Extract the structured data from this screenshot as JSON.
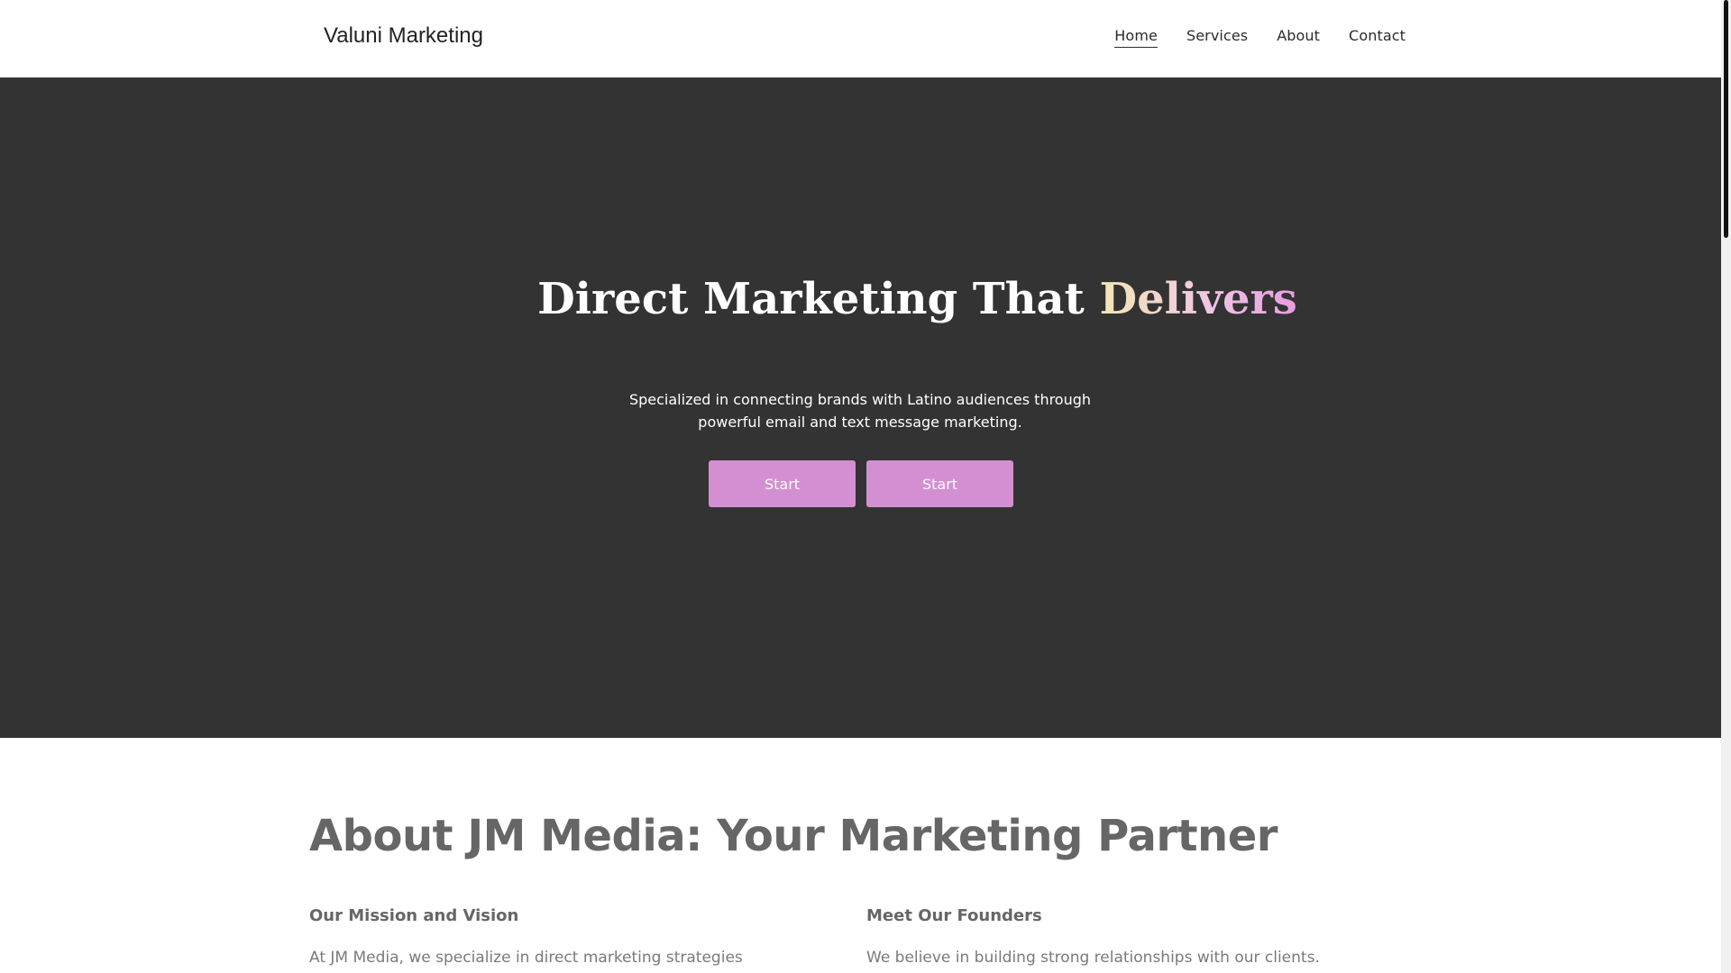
{
  "header": {
    "brand": "Valuni Marketing",
    "nav": [
      "Home",
      "Services",
      "About",
      "Contact"
    ],
    "active_nav": "Home"
  },
  "hero": {
    "title_main": "Direct Marketing That ",
    "title_accent": "Delivers",
    "subtitle": "Specialized in connecting brands with Latino audiences through powerful email and text message marketing.",
    "buttons": [
      "Start",
      "Start"
    ]
  },
  "about": {
    "title": "About JM Media: Your Marketing Partner",
    "columns": [
      {
        "heading": "Our Mission and Vision",
        "text": "At JM Media, we specialize in direct marketing strategies that"
      },
      {
        "heading": "Meet Our Founders",
        "text": "We believe in building strong relationships with our clients. Our"
      }
    ]
  },
  "colors": {
    "hero_bg": "#333333",
    "button_bg": "#d38fd1",
    "accent_gradient_start": "#f4e7b3",
    "accent_gradient_end": "#e79ce0"
  }
}
